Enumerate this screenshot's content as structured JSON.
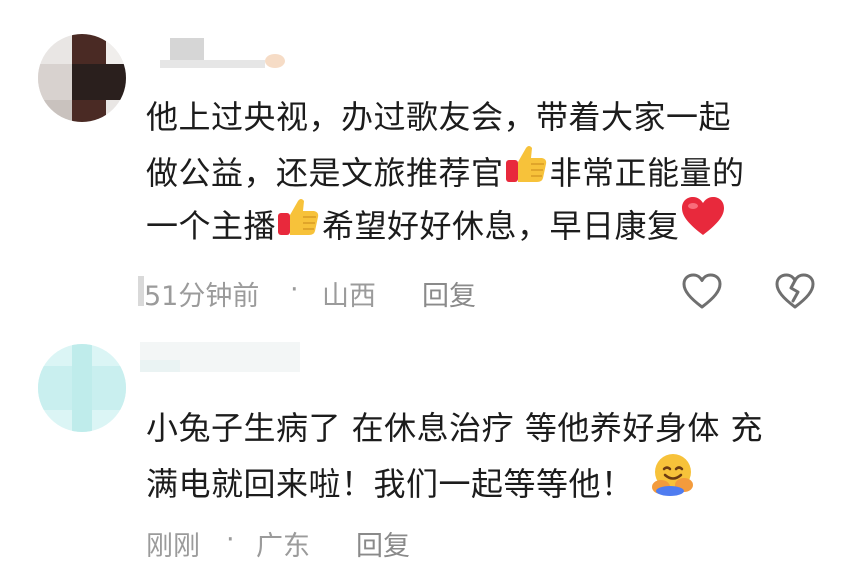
{
  "comments": [
    {
      "line1": "他上过央视，办过歌友会，带着大家一起",
      "line2a": "做公益，还是文旅推荐官",
      "line2b": "非常正能量的",
      "line3a": "一个主播",
      "line3b": "希望好好休息，早日康复",
      "time": "51分钟前",
      "sep": "·",
      "location": "山西",
      "reply_label": "回复",
      "emojis": [
        "thumbs-up-emoji",
        "thumbs-up-emoji",
        "red-heart-emoji"
      ],
      "actions": [
        "like-heart-icon",
        "dislike-broken-heart-icon"
      ]
    },
    {
      "line1": "小兔子生病了 在休息治疗 等他养好身体 充",
      "line2": "满电就回来啦！我们一起等等他！",
      "time": "刚刚",
      "sep": "·",
      "location": "广东",
      "reply_label": "回复",
      "emojis": [
        "hugging-face-emoji"
      ]
    }
  ],
  "colors": {
    "body_text": "#1c1c1c",
    "meta_text": "#9b9b9b",
    "icon_stroke": "#6f6f6f",
    "heart_red": "#e8293c",
    "thumb_yellow": "#f7c23a"
  }
}
